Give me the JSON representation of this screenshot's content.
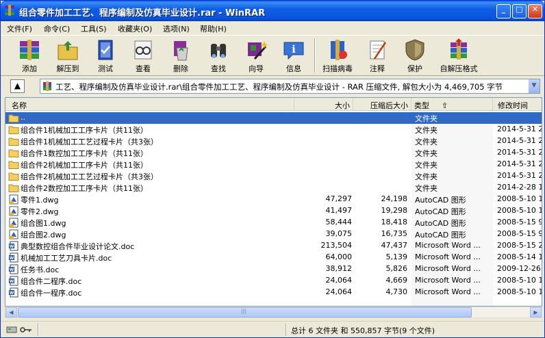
{
  "window": {
    "title": "组合零件加工工艺、程序编制及仿真毕业设计.rar - WinRAR",
    "min_label": "_",
    "max_label": "□",
    "close_label": "✕"
  },
  "menu": [
    "文件(F)",
    "命令(C)",
    "工具(S)",
    "收藏夹(O)",
    "选项(N)",
    "帮助(H)"
  ],
  "toolbar": [
    {
      "label": "添加",
      "icon": "add-books-icon"
    },
    {
      "label": "解压到",
      "icon": "extract-to-folder-icon"
    },
    {
      "label": "测试",
      "icon": "test-book-icon"
    },
    {
      "label": "查看",
      "icon": "view-glasses-icon"
    },
    {
      "label": "删除",
      "icon": "delete-recycle-icon"
    },
    {
      "label": "查找",
      "icon": "find-binoculars-icon"
    },
    {
      "label": "向导",
      "icon": "wizard-wand-icon"
    },
    {
      "label": "信息",
      "icon": "info-icon"
    },
    {
      "label": "扫描病毒",
      "icon": "virus-scan-icon"
    },
    {
      "label": "注释",
      "icon": "comment-icon"
    },
    {
      "label": "保护",
      "icon": "protect-shield-icon"
    },
    {
      "label": "自解压格式",
      "icon": "sfx-icon"
    }
  ],
  "address": {
    "up_label": "▲",
    "path": "工艺、程序编制及仿真毕业设计.rar\\组合零件加工工艺、程序编制及仿真毕业设计 - RAR 压缩文件, 解包大小为 4,469,705 字节"
  },
  "columns": {
    "name": "名称",
    "size": "大小",
    "packed": "压缩后大小",
    "type": "类型",
    "modified": "修改时间",
    "sort_arrow": "⇧"
  },
  "rows": [
    {
      "icon": "folder",
      "name": "..",
      "size": "",
      "packed": "",
      "type": "文件夹",
      "modified": "",
      "selected": true
    },
    {
      "icon": "folder",
      "name": "组合件1机械加工工序卡片（共11张）",
      "size": "",
      "packed": "",
      "type": "文件夹",
      "modified": "2014-5-31 2"
    },
    {
      "icon": "folder",
      "name": "组合件1机械加工工艺过程卡片（共3张）",
      "size": "",
      "packed": "",
      "type": "文件夹",
      "modified": "2014-5-31 2"
    },
    {
      "icon": "folder",
      "name": "组合件1数控加工工序卡片（共11张）",
      "size": "",
      "packed": "",
      "type": "文件夹",
      "modified": "2014-5-31 2"
    },
    {
      "icon": "folder",
      "name": "组合件2机械加工工序卡片（共11张）",
      "size": "",
      "packed": "",
      "type": "文件夹",
      "modified": "2014-5-31 2"
    },
    {
      "icon": "folder",
      "name": "组合件2机械加工工艺过程卡片（共3张）",
      "size": "",
      "packed": "",
      "type": "文件夹",
      "modified": "2014-5-31 2"
    },
    {
      "icon": "folder",
      "name": "组合件2数控加工工序卡片（共11张）",
      "size": "",
      "packed": "",
      "type": "文件夹",
      "modified": "2014-2-28 1"
    },
    {
      "icon": "dwg",
      "name": "零件1.dwg",
      "size": "47,297",
      "packed": "24,198",
      "type": "AutoCAD 图形",
      "modified": "2008-5-10 1"
    },
    {
      "icon": "dwg",
      "name": "零件2.dwg",
      "size": "41,497",
      "packed": "19,298",
      "type": "AutoCAD 图形",
      "modified": "2008-5-10 1"
    },
    {
      "icon": "dwg",
      "name": "组合图1.dwg",
      "size": "58,444",
      "packed": "18,418",
      "type": "AutoCAD 图形",
      "modified": "2008-5-15 9"
    },
    {
      "icon": "dwg",
      "name": "组合图2.dwg",
      "size": "39,075",
      "packed": "16,735",
      "type": "AutoCAD 图形",
      "modified": "2008-5-15 9"
    },
    {
      "icon": "doc",
      "name": "典型数控组合件毕业设计论文.doc",
      "size": "213,504",
      "packed": "47,437",
      "type": "Microsoft Word ...",
      "modified": "2008-5-15 2"
    },
    {
      "icon": "doc",
      "name": "机械加工工艺刀具卡片.doc",
      "size": "64,000",
      "packed": "5,139",
      "type": "Microsoft Word ...",
      "modified": "2008-5-14 1"
    },
    {
      "icon": "doc",
      "name": "任务书.doc",
      "size": "38,912",
      "packed": "5,826",
      "type": "Microsoft Word ...",
      "modified": "2009-12-26"
    },
    {
      "icon": "doc",
      "name": "组合件二程序.doc",
      "size": "24,064",
      "packed": "4,669",
      "type": "Microsoft Word ...",
      "modified": "2008-5-10 1"
    },
    {
      "icon": "doc",
      "name": "组合件一程序.doc",
      "size": "24,064",
      "packed": "4,730",
      "type": "Microsoft Word ...",
      "modified": "2008-5-10 1"
    }
  ],
  "scrollbar": {
    "left_arrow": "◀",
    "right_arrow": "▶",
    "grip": "|||"
  },
  "status": {
    "summary": "总计 6 文件夹 和 550,857 字节(9 个文件)"
  },
  "colors": {
    "titlebar": "#0b54dc",
    "selection": "#316ac5",
    "window_bg": "#ece9d8"
  }
}
